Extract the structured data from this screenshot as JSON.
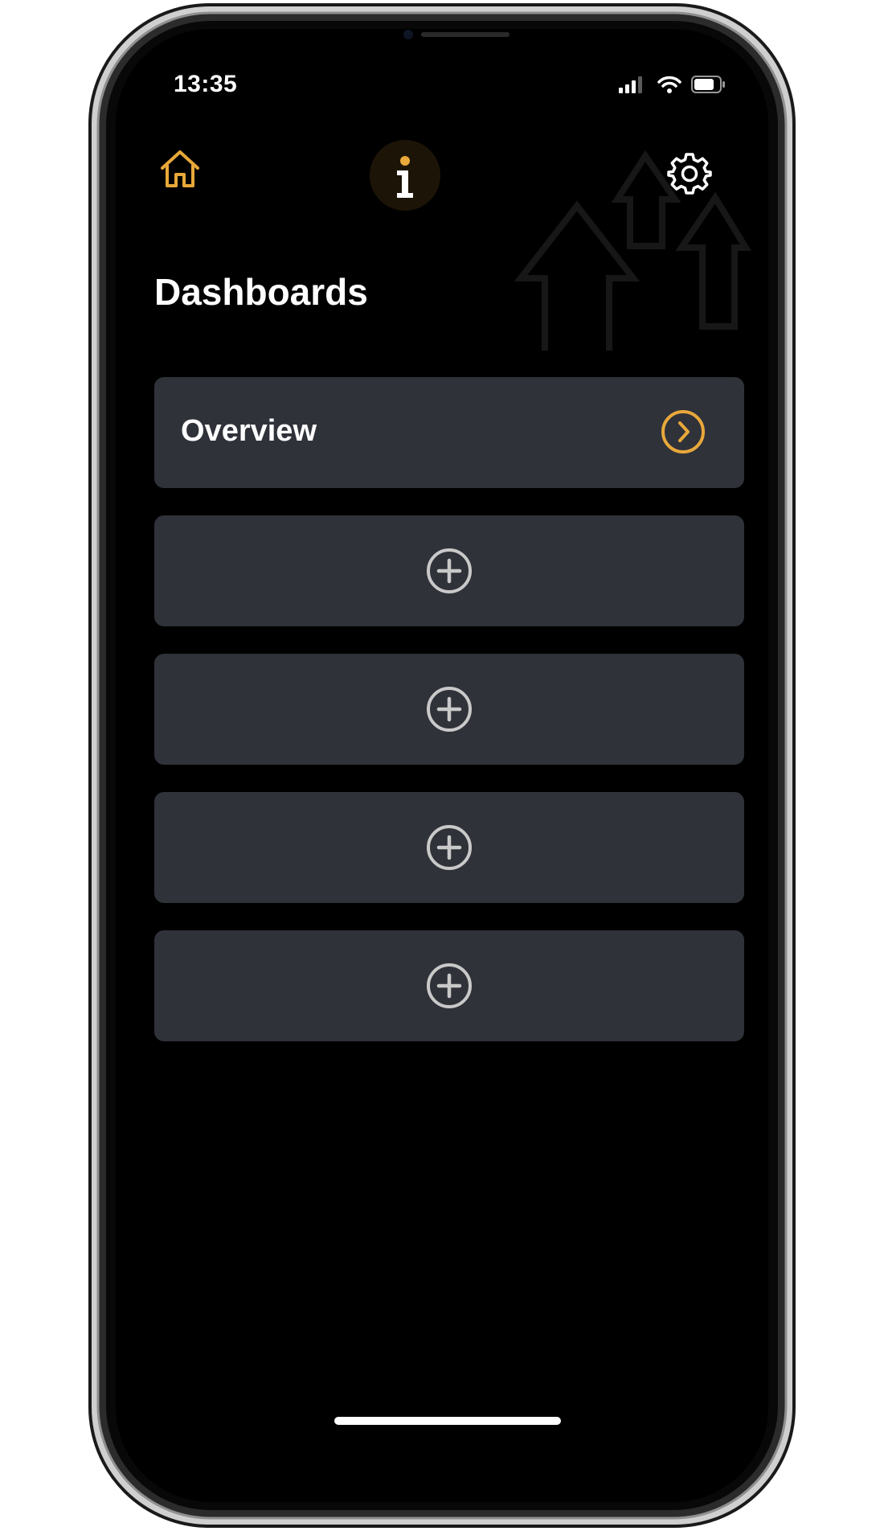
{
  "status_bar": {
    "time": "13:35",
    "signal_icon": "cellular-signal-icon",
    "wifi_icon": "wifi-icon",
    "battery_icon": "battery-icon"
  },
  "header": {
    "home_icon": "home-icon",
    "logo_icon": "info-logo-icon",
    "settings_icon": "gear-icon"
  },
  "page": {
    "title": "Dashboards"
  },
  "dashboards": [
    {
      "label": "Overview",
      "icon": "chevron-right-circle-icon"
    },
    {
      "label": "",
      "icon": "plus-circle-icon"
    },
    {
      "label": "",
      "icon": "plus-circle-icon"
    },
    {
      "label": "",
      "icon": "plus-circle-icon"
    },
    {
      "label": "",
      "icon": "plus-circle-icon"
    }
  ],
  "colors": {
    "accent": "#e8a83a",
    "background": "#000000",
    "card": "#30323a",
    "plus_icon": "#c9c9c9",
    "text": "#ffffff"
  }
}
